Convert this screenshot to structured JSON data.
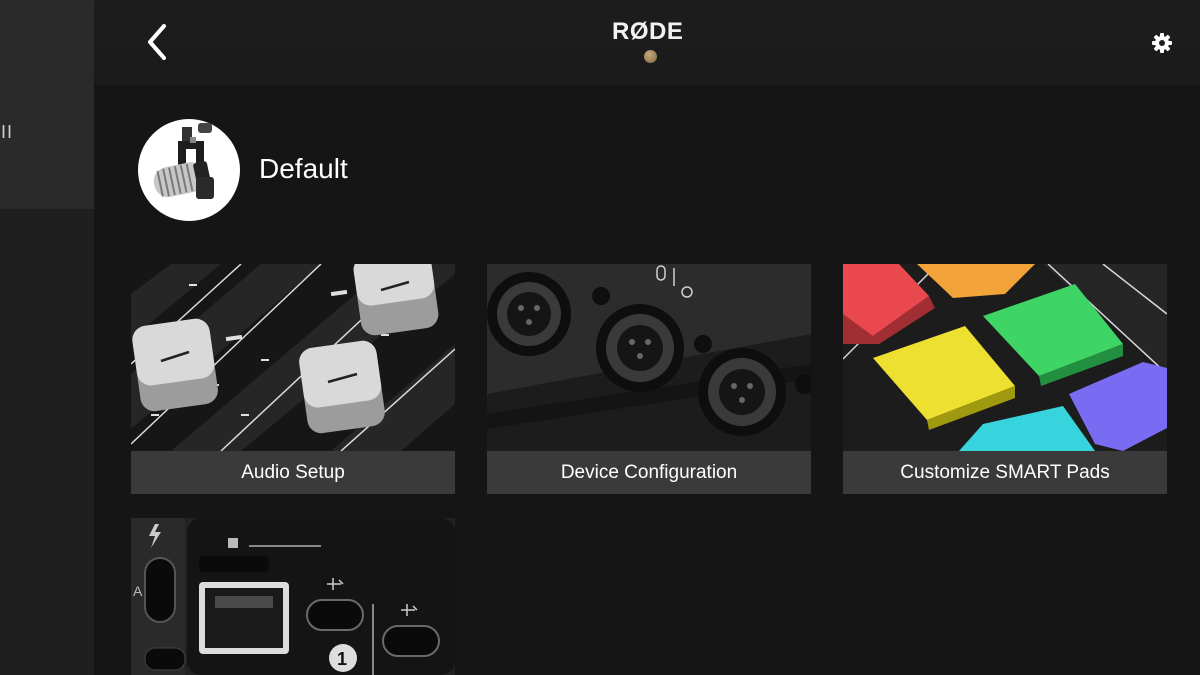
{
  "sidebar": {
    "items": [
      {
        "label": "II"
      }
    ]
  },
  "header": {
    "logo": "RØDE",
    "status_color": "#b09068"
  },
  "profile": {
    "name": "Default"
  },
  "tiles": [
    {
      "label": "Audio Setup"
    },
    {
      "label": "Device Configuration"
    },
    {
      "label": "Customize SMART Pads"
    },
    {
      "label": ""
    }
  ],
  "colors": {
    "background": "#151515",
    "topbar": "#1d1d1d",
    "tile_label_bg": "#3a3a3a",
    "pad_red": "#f0555a",
    "pad_orange": "#f3a83a",
    "pad_green": "#3fd86a",
    "pad_yellow": "#f0e030",
    "pad_cyan": "#36d6e0",
    "pad_purple": "#7b6cf0"
  }
}
